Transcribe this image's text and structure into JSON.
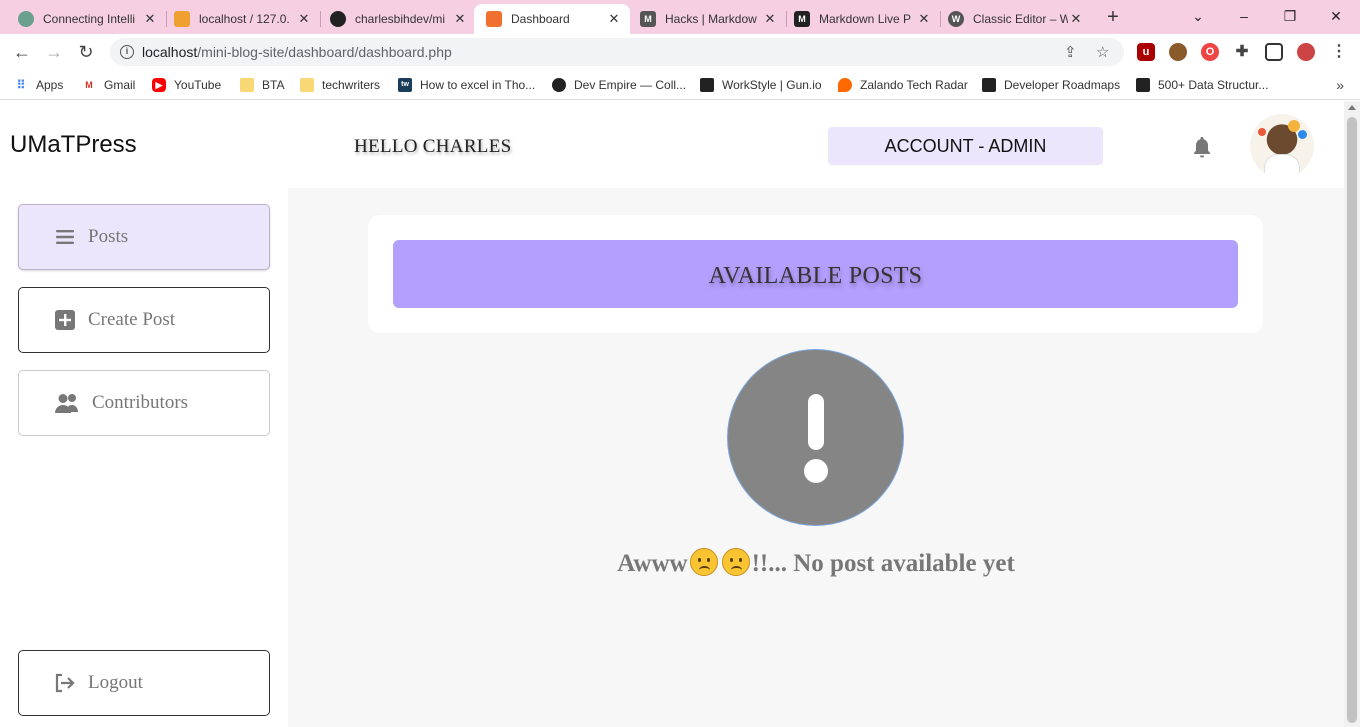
{
  "browser": {
    "tabs": [
      {
        "title": "Connecting Intelli",
        "favicon": "chatgpt-icon"
      },
      {
        "title": "localhost / 127.0.",
        "favicon": "phpmyadmin-icon"
      },
      {
        "title": "charlesbihdev/mi",
        "favicon": "github-icon"
      },
      {
        "title": "Dashboard",
        "favicon": "xampp-icon",
        "active": true
      },
      {
        "title": "Hacks | Markdow",
        "favicon": "markdown-icon"
      },
      {
        "title": "Markdown Live P",
        "favicon": "medium-icon"
      },
      {
        "title": "Classic Editor – W",
        "favicon": "wordpress-icon"
      }
    ],
    "url_host": "localhost",
    "url_path": "/mini-blog-site/dashboard/dashboard.php",
    "bookmarks": [
      {
        "label": "Apps",
        "icon": "apps-grid-icon"
      },
      {
        "label": "Gmail",
        "icon": "gmail-icon"
      },
      {
        "label": "YouTube",
        "icon": "youtube-icon"
      },
      {
        "label": "BTA",
        "icon": "folder-icon"
      },
      {
        "label": "techwriters",
        "icon": "folder-icon"
      },
      {
        "label": "How to excel in Tho...",
        "icon": "tw-icon"
      },
      {
        "label": "Dev Empire — Coll...",
        "icon": "globe-icon"
      },
      {
        "label": "WorkStyle | Gun.io",
        "icon": "gunio-icon"
      },
      {
        "label": "Zalando Tech Radar",
        "icon": "zalando-icon"
      },
      {
        "label": "Developer Roadmaps",
        "icon": "roadmap-icon"
      },
      {
        "label": "500+ Data Structur...",
        "icon": "medium-icon"
      }
    ]
  },
  "header": {
    "logo": "UMaTPress",
    "greeting": "HELLO CHARLES",
    "account": "ACCOUNT - ADMIN"
  },
  "sidebar": {
    "items": [
      {
        "label": "Posts",
        "icon": "menu-lines-icon"
      },
      {
        "label": "Create Post",
        "icon": "plus-square-icon"
      },
      {
        "label": "Contributors",
        "icon": "users-icon"
      }
    ],
    "logout": "Logout"
  },
  "main": {
    "banner": "AVAILABLE POSTS",
    "empty_prefix": "Awww",
    "empty_suffix": "!!... No post available yet"
  },
  "colors": {
    "accent_banner": "#b39ffe",
    "accent_light": "#ece6fd",
    "tabstrip": "#f6cfe3",
    "alert_grey": "#858585"
  }
}
